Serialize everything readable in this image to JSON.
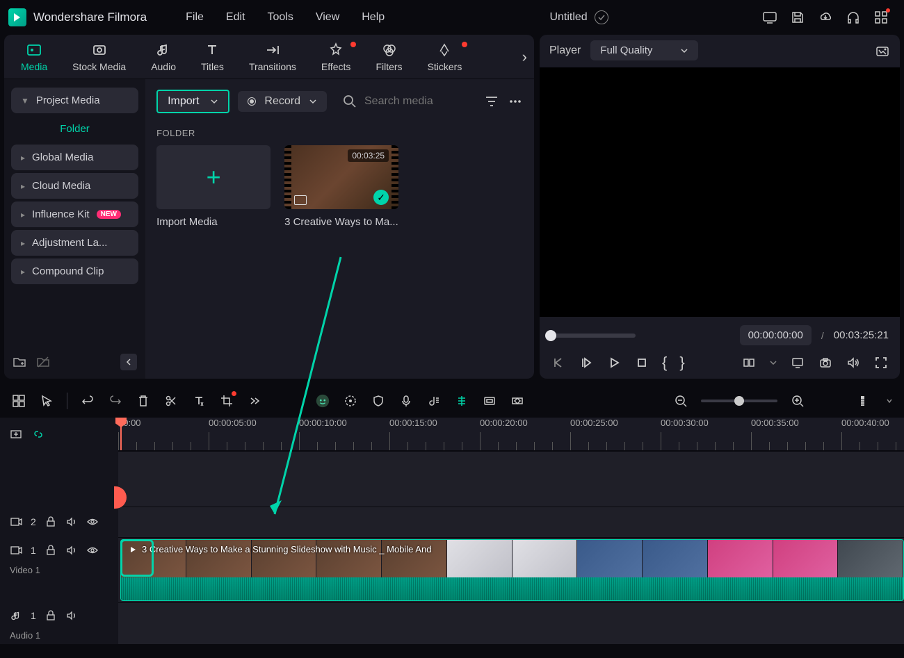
{
  "app": {
    "name": "Wondershare Filmora"
  },
  "menu": {
    "file": "File",
    "edit": "Edit",
    "tools": "Tools",
    "view": "View",
    "help": "Help"
  },
  "document": {
    "title": "Untitled"
  },
  "tabs": {
    "media": "Media",
    "stock": "Stock Media",
    "audio": "Audio",
    "titles": "Titles",
    "transitions": "Transitions",
    "effects": "Effects",
    "filters": "Filters",
    "stickers": "Stickers"
  },
  "sidebar": {
    "project_media": "Project Media",
    "folder": "Folder",
    "global_media": "Global Media",
    "cloud_media": "Cloud Media",
    "influence_kit": "Influence Kit",
    "influence_new": "NEW",
    "adjustment": "Adjustment La...",
    "compound": "Compound Clip"
  },
  "toolbar": {
    "import": "Import",
    "record": "Record",
    "search_placeholder": "Search media"
  },
  "folder_label": "FOLDER",
  "media_items": {
    "import_card": "Import Media",
    "video1_caption": "3 Creative Ways to Ma...",
    "video1_duration": "00:03:25"
  },
  "player": {
    "label": "Player",
    "quality": "Full Quality",
    "current_time": "00:00:00:00",
    "total_time": "00:03:25:21",
    "separator": "/"
  },
  "ruler": {
    "t0": "00:00",
    "t1": "00:00:05:00",
    "t2": "00:00:10:00",
    "t3": "00:00:15:00",
    "t4": "00:00:20:00",
    "t5": "00:00:25:00",
    "t6": "00:00:30:00",
    "t7": "00:00:35:00",
    "t8": "00:00:40:00"
  },
  "tracks": {
    "video2_num": "2",
    "video1_num": "1",
    "video1_name": "Video 1",
    "audio1_num": "1",
    "audio1_name": "Audio 1"
  },
  "clip": {
    "title": "3 Creative Ways to Make a Stunning Slideshow with Music _ Mobile And"
  }
}
